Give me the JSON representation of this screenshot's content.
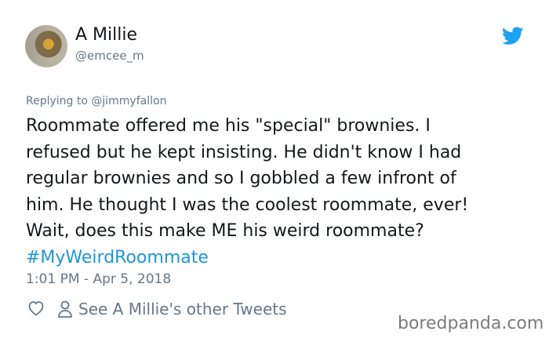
{
  "author": {
    "name": "A Millie",
    "handle": "@emcee_m"
  },
  "replying_to": "Replying to @jimmyfallon",
  "tweet": {
    "lines": [
      "Roommate offered me his \"special\" brownies. I",
      "refused but he kept insisting. He didn't know I had",
      "regular brownies and so I gobbled a few infront of",
      "him. He thought I was the coolest roommate, ever!",
      "Wait, does this make ME his weird roommate?"
    ],
    "hashtag": "#MyWeirdRoommate"
  },
  "timestamp": "1:01 PM - Apr 5, 2018",
  "actions": {
    "see_more": "See A Millie's other Tweets"
  },
  "watermark": "boredpanda.com",
  "colors": {
    "accent": "#1b95e0",
    "muted": "#657786",
    "text": "#14171a"
  },
  "icons": [
    "twitter-bird-icon",
    "heart-icon",
    "person-icon"
  ]
}
